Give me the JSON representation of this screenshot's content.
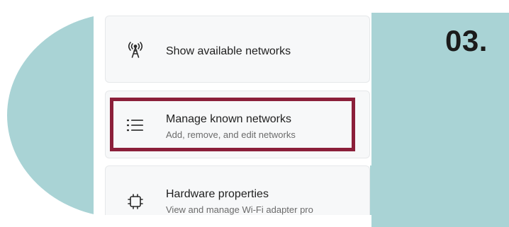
{
  "step_number": "03.",
  "menu": {
    "items": [
      {
        "icon": "broadcast-antenna-icon",
        "label": "Show available networks"
      },
      {
        "icon": "list-icon",
        "label": "Manage known networks",
        "sublabel": "Add, remove, and edit networks"
      },
      {
        "icon": "chip-icon",
        "label": "Hardware properties",
        "sublabel": "View and manage Wi-Fi adapter pro"
      }
    ]
  },
  "colors": {
    "accent_teal": "#a9d3d5",
    "highlight_border": "#8b1f3a",
    "card_bg": "#f7f8f9"
  }
}
